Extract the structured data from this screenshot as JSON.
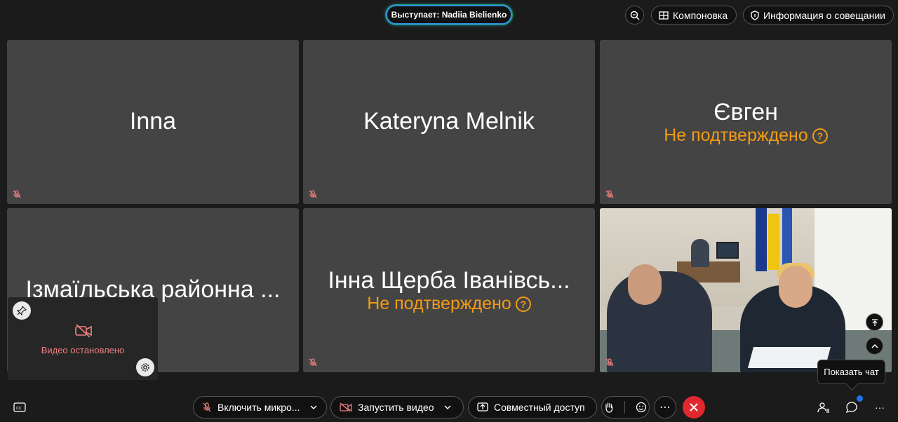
{
  "top": {
    "speaker": "Выступает: Nadiia Bielienko",
    "layout_label": "Компоновка",
    "info_label": "Информация о совещании"
  },
  "tiles": [
    {
      "name": "Inna",
      "unconfirmed": ""
    },
    {
      "name": "Kateryna Melnik",
      "unconfirmed": ""
    },
    {
      "name": "Євген",
      "unconfirmed": "Не подтверждено"
    },
    {
      "name": "Ізмаїльська районна ...",
      "unconfirmed": ""
    },
    {
      "name": "Інна Щерба Іванівсь...",
      "unconfirmed": "Не подтверждено"
    }
  ],
  "self_view": {
    "label": "Видео остановлено"
  },
  "tooltip": "Показать чат",
  "bottom": {
    "mic_label": "Включить микро...",
    "video_label": "Запустить видео",
    "share_label": "Совместный доступ"
  },
  "colors": {
    "tile_bg": "#444444",
    "unconfirmed": "#f29b16",
    "end_call": "#e0282e",
    "muted_icon": "#f08080"
  }
}
